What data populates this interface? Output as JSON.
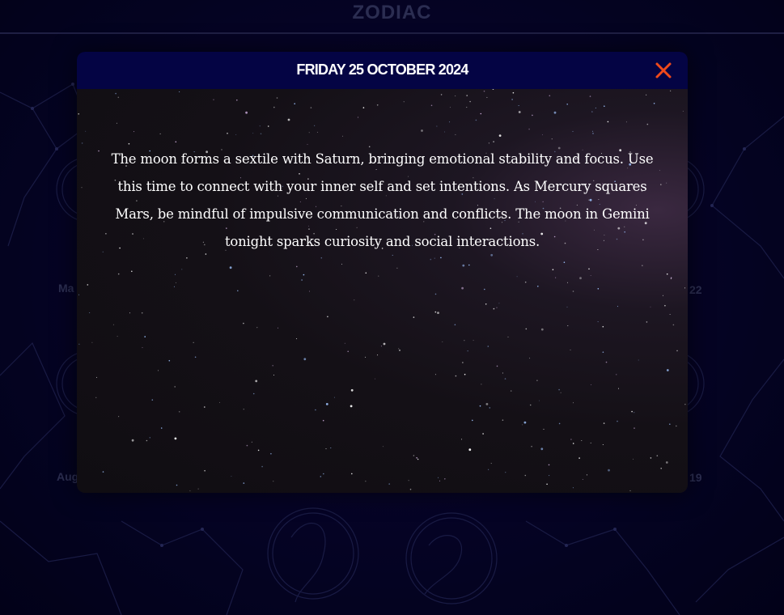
{
  "background": {
    "title": "ZODIAC",
    "labels": [
      "Ma",
      "Aug",
      "22",
      "19"
    ]
  },
  "modal": {
    "title": "FRIDAY 25 OCTOBER 2024",
    "close_icon": "close-icon",
    "body_text": "The moon forms a sextile with Saturn, bringing emotional stability and focus. Use this time to connect with your inner self and set intentions. As Mercury squares Mars, be mindful of impulsive communication and conflicts. The moon in Gemini tonight sparks curiosity and social interactions."
  },
  "colors": {
    "modal_header": "#040444",
    "close_icon": "#f04a1a",
    "page_background": "#04031f"
  }
}
